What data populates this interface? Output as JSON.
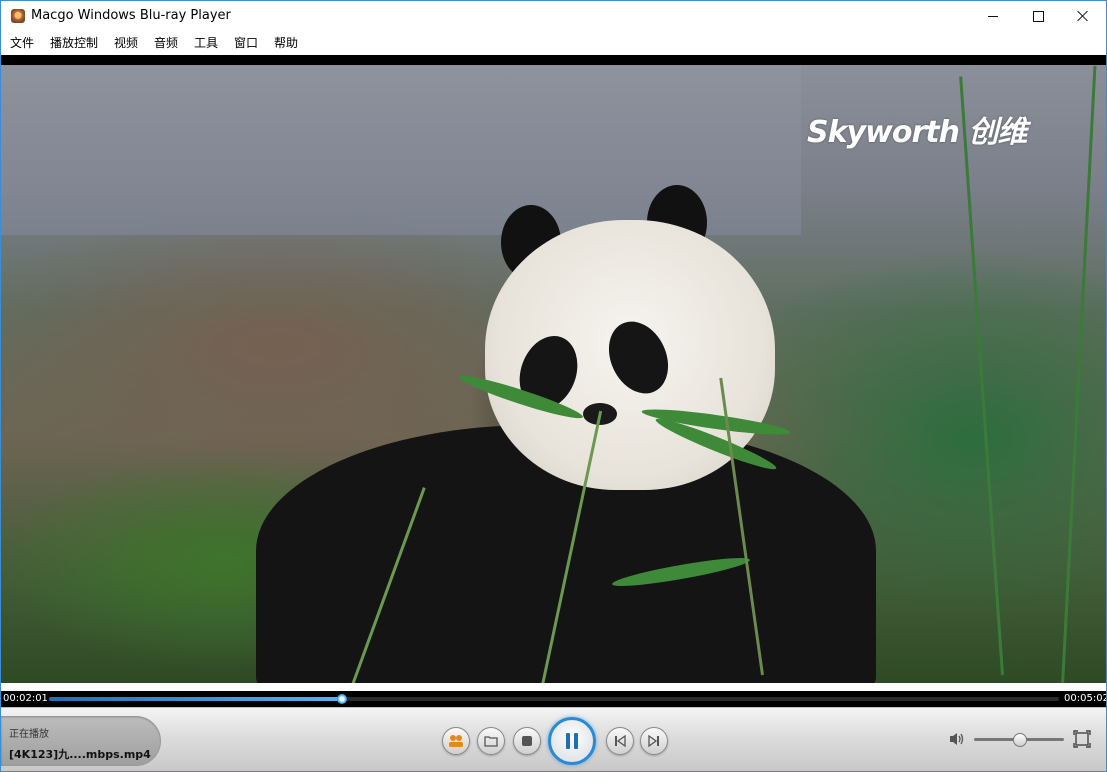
{
  "window": {
    "title": "Macgo Windows Blu-ray Player",
    "icons": {
      "app": "app-logo-icon",
      "minimize": "minimize-icon",
      "maximize": "maximize-icon",
      "close": "close-icon"
    }
  },
  "menu": {
    "items": [
      {
        "label": "文件"
      },
      {
        "label": "播放控制"
      },
      {
        "label": "视频"
      },
      {
        "label": "音频"
      },
      {
        "label": "工具"
      },
      {
        "label": "窗口"
      },
      {
        "label": "帮助"
      }
    ]
  },
  "video": {
    "watermark": "Skyworth 创维"
  },
  "playback": {
    "current_time": "00:02:01",
    "total_time": "00:05:02",
    "progress_fraction": 0.29,
    "volume_fraction": 0.5
  },
  "nowplaying": {
    "label": "正在播放",
    "filename": "[4K123]九....mbps.mp4"
  },
  "controls": {
    "icons": {
      "playlist": "playlist-people-icon",
      "open": "open-folder-icon",
      "stop": "stop-icon",
      "pause": "pause-icon",
      "previous": "previous-icon",
      "next": "next-icon",
      "volume": "speaker-icon",
      "fullscreen": "fullscreen-icon"
    },
    "accent_color": "#2a8ad6"
  }
}
